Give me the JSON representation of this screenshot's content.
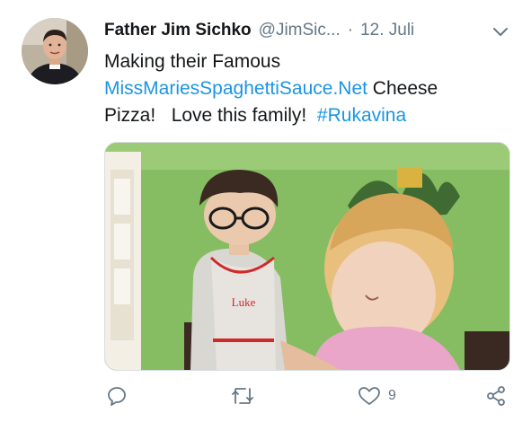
{
  "tweet": {
    "author_name": "Father Jim Sichko",
    "author_handle": "@JimSic...",
    "separator": "·",
    "date": "12. Juli",
    "text_line1": "Making their Famous",
    "link": "MissMariesSpaghettiSauce.Net",
    "text_after_link": " Cheese",
    "text_line3": "Pizza!   Love this family!  ",
    "hashtag": "#Rukavina",
    "apron_text": "Luke",
    "like_count": "9",
    "colors": {
      "link": "#1b95e0",
      "secondary": "#657786",
      "primary_text": "#14171a"
    },
    "icons": {
      "menu": "chevron-down-icon",
      "reply": "reply-icon",
      "retweet": "retweet-icon",
      "like": "heart-icon",
      "share": "share-icon"
    }
  }
}
